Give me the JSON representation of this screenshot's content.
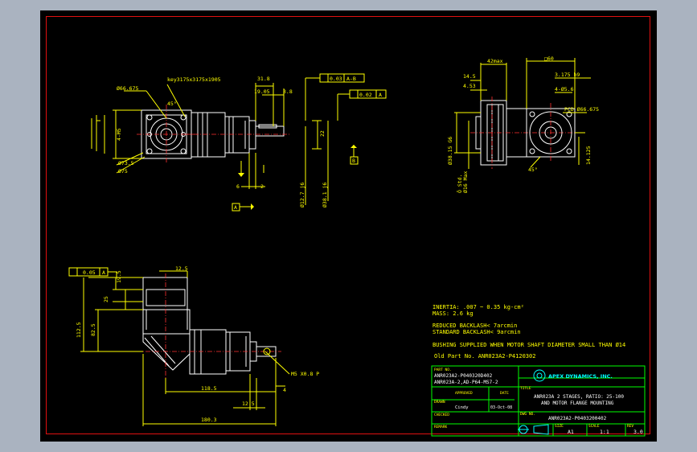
{
  "drawing": {
    "notes": {
      "inertia": "INERTIA: .007 ~ 0.35 kg-cm²",
      "mass": "MASS: 2.6 kg",
      "reduced_backlash": "REDUCED BACKLASH< 7arcmin",
      "standard_backlash": "STANDARD BACKLASH< 9arcmin",
      "bushing": "BUSHING SUPPLIED WHEN MOTOR SHAFT DIAMETER SMALL THAN Ø14",
      "old_part": "Old Part No. ANR023A2-P4120302"
    },
    "dims_top_left": {
      "key": "key3175x3175x1905",
      "d66": "Ø66.675",
      "a45": "45°",
      "d73": "Ø73.5",
      "d75": "Ø75",
      "n4m5": "4-M5",
      "d318": "31.8",
      "d1905": "19.05",
      "d38": "3.8",
      "d22": "22",
      "d127": "Ø12.7 j6",
      "d381": "Ø38.1 j6",
      "d6": "6",
      "d2": "2",
      "gdt_perp": "0.03",
      "gdt_ref": "A-B",
      "gdt_par": "0.02",
      "gdt_a": "A",
      "datum_a": "A",
      "datum_b": "B"
    },
    "dims_top_right": {
      "d42": "42max",
      "sq60": "□60",
      "d3175": "3.175 h9",
      "n456": "4-Ø5.6",
      "pcd": "PCD Ø66.675",
      "d145": "14.5",
      "d453": "4.53",
      "d3815": "Ø38.15 G6",
      "dstd": "Ô Std.",
      "dmax": "Ø16 Max",
      "a45": "45°",
      "d14125": "14.125"
    },
    "dims_bottom": {
      "gdt_perp": "0.05",
      "gdt_a": "A",
      "d125a": "12.5",
      "d195": "19.5",
      "d25": "25",
      "d825": "82.5",
      "d1125": "112.5",
      "d1185": "118.5",
      "d4": "4",
      "d125b": "12.5",
      "d1803": "180.3",
      "m5": "M5 X0.8 P"
    },
    "title_block": {
      "part_no_label": "PART NO.",
      "part_no_1": "ANR023A2-P040320D402",
      "part_no_2": "ANR023A-2,AD-P64-MS7-2",
      "title_label": "TITLE",
      "company": "APEX DYNAMICS, INC.",
      "title_line1": "ANR023A 2 STAGES, RATIO: 25-100",
      "title_line2": "AND MOTOR FLANGE MOUNTING",
      "approved_label": "APPROVED",
      "date_label": "DATE",
      "drawn_label": "DRAWN",
      "drawn_by": "Cindy",
      "drawn_date": "03-Oct-08",
      "checked_label": "CHECKED",
      "dwg_label": "DWG NO.",
      "dwg_no": "ANR023A2-P0403200402",
      "remark_label": "REMARK",
      "size_label": "SIZE",
      "size": "A1",
      "scale_label": "SCALE",
      "scale": "1:1",
      "rev_label": "REV",
      "rev": "3.0"
    }
  }
}
